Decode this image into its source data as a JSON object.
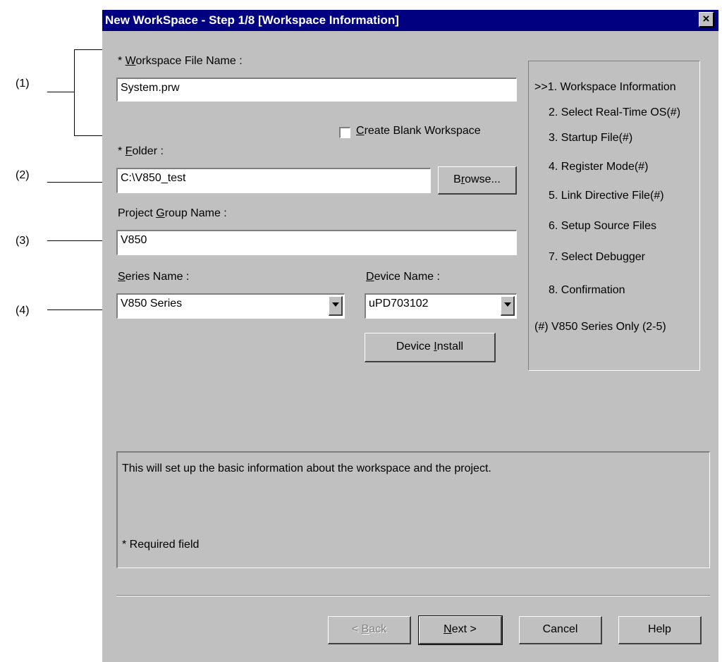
{
  "annotations": [
    "(1)",
    "(2)",
    "(3)",
    "(4)"
  ],
  "dialog": {
    "title": "New WorkSpace - Step 1/8 [Workspace Information]",
    "close_glyph": "×"
  },
  "workspace_file": {
    "label_prefix": "* ",
    "label_mnemonic": "W",
    "label_rest": "orkspace File Name :",
    "value": "System.prw"
  },
  "create_blank": {
    "mnemonic": "C",
    "rest": "reate Blank Workspace",
    "checked": false
  },
  "folder": {
    "label_prefix": "* ",
    "label_mnemonic": "F",
    "label_rest": "older :",
    "value": "C:\\V850_test",
    "browse_pre": "B",
    "browse_mnemonic": "r",
    "browse_post": "owse..."
  },
  "project_group": {
    "label_pre": "Project ",
    "label_mnemonic": "G",
    "label_rest": "roup Name :",
    "value": "V850"
  },
  "series": {
    "label_mnemonic": "S",
    "label_rest": "eries Name :",
    "value": "V850 Series"
  },
  "device": {
    "label_mnemonic": "D",
    "label_rest": "evice Name :",
    "value": "uPD703102",
    "install_pre": "Device ",
    "install_mnemonic": "I",
    "install_post": "nstall"
  },
  "steps": [
    ">>1. Workspace Information",
    "2. Select Real-Time OS(#)",
    "3. Startup File(#)",
    "4. Register Mode(#)",
    "5. Link Directive File(#)",
    "6. Setup Source Files",
    "7. Select Debugger",
    "8. Confirmation",
    "(#) V850 Series Only (2-5)"
  ],
  "info": {
    "description": "This will set up the basic information about the workspace and the project.",
    "required_note": "* Required field"
  },
  "buttons": {
    "back_pre": "< ",
    "back_mnemonic": "B",
    "back_post": "ack",
    "next_mnemonic": "N",
    "next_post": "ext >",
    "cancel": "Cancel",
    "help": "Help"
  }
}
